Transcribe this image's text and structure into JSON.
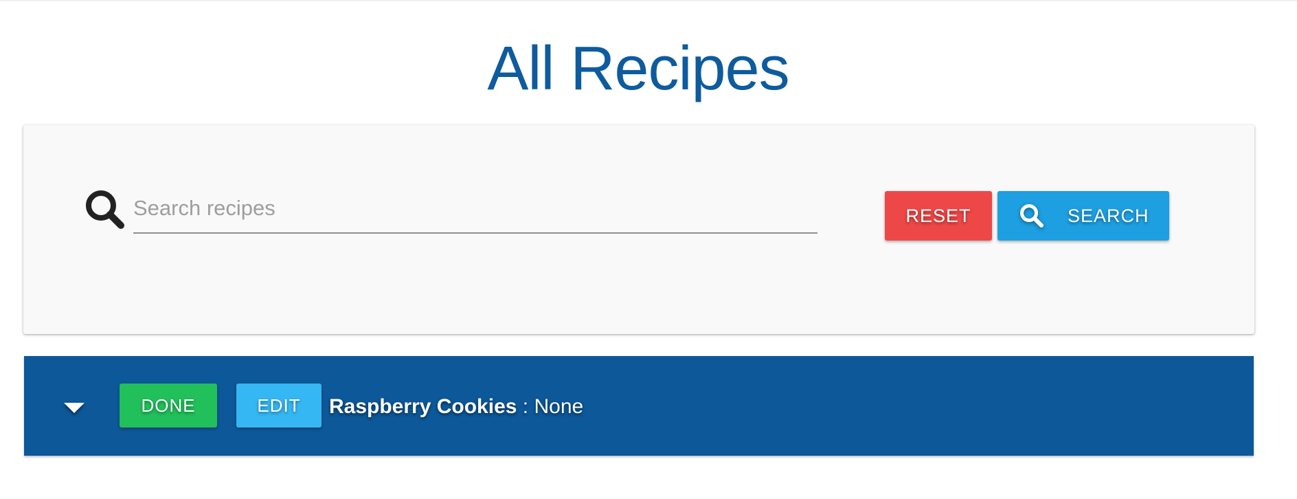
{
  "page": {
    "title": "All Recipes"
  },
  "search": {
    "placeholder": "Search recipes",
    "value": "",
    "icon": "search-icon",
    "reset_label": "RESET",
    "search_label": "SEARCH"
  },
  "recipes": [
    {
      "name": "Raspberry Cookies",
      "separator": " : ",
      "status": "None",
      "done_label": "DONE",
      "edit_label": "EDIT",
      "toggle_icon": "caret-down-icon"
    }
  ],
  "colors": {
    "title": "#0e5b9e",
    "reset": "#ee4747",
    "search": "#1d9fe1",
    "row_background": "#0d5899",
    "done": "#21c05a",
    "edit": "#35b7f3"
  }
}
